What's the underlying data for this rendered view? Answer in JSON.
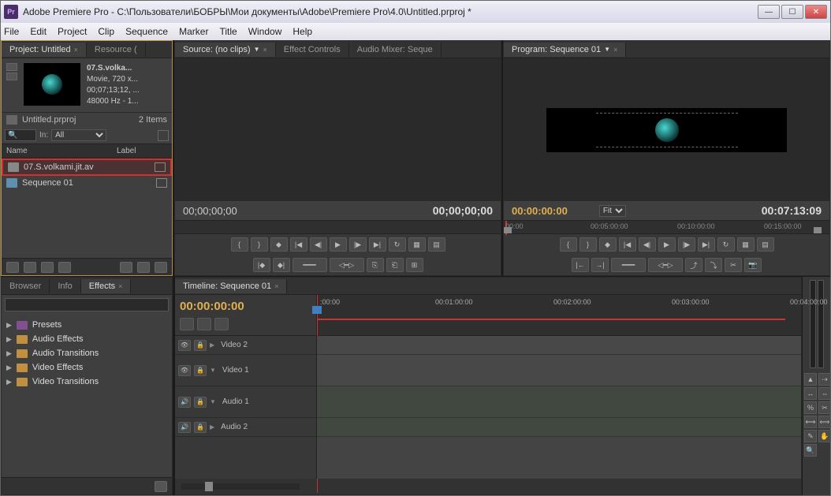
{
  "window": {
    "title": "Adobe Premiere Pro - C:\\Пользователи\\БОБРЫ\\Мои документы\\Adobe\\Premiere Pro\\4.0\\Untitled.prproj *",
    "app_abbrev": "Pr"
  },
  "menubar": [
    "File",
    "Edit",
    "Project",
    "Clip",
    "Sequence",
    "Marker",
    "Title",
    "Window",
    "Help"
  ],
  "project_panel": {
    "tab_active": "Project: Untitled",
    "tab_inactive": "Resource (",
    "clip": {
      "name": "07.S.volka...",
      "line2": "Movie, 720 x...",
      "line3": "00;07;13;12, ...",
      "line4": "48000 Hz - 1..."
    },
    "path_name": "Untitled.prproj",
    "item_count": "2 Items",
    "in_label": "In:",
    "in_value": "All",
    "col_name": "Name",
    "col_label": "Label",
    "rows": [
      {
        "name": "07.S.volkami.jit.av"
      },
      {
        "name": "Sequence 01"
      }
    ]
  },
  "source_panel": {
    "tab": "Source: (no clips)",
    "tab_effect": "Effect Controls",
    "tab_audio": "Audio Mixer: Seque",
    "tc_left": "00;00;00;00",
    "tc_right": "00;00;00;00"
  },
  "program_panel": {
    "tab": "Program: Sequence 01",
    "tc_left": "00:00:00:00",
    "fit": "Fit",
    "tc_right": "00:07:13:09",
    "ruler": [
      "00:00",
      "00:05:00:00",
      "00:10:00:00",
      "00:15:00:00"
    ]
  },
  "lower_tabs": {
    "browser": "Browser",
    "info": "Info",
    "effects": "Effects"
  },
  "effects": {
    "items": [
      "Presets",
      "Audio Effects",
      "Audio Transitions",
      "Video Effects",
      "Video Transitions"
    ]
  },
  "timeline": {
    "tab": "Timeline: Sequence 01",
    "tc": "00:00:00:00",
    "ruler": [
      ":00:00",
      "00:01:00:00",
      "00:02:00:00",
      "00:03:00:00",
      "00:04:00:00"
    ],
    "tracks": {
      "v2": "Video 2",
      "v1": "Video 1",
      "a1": "Audio 1",
      "a2": "Audio 2"
    }
  }
}
